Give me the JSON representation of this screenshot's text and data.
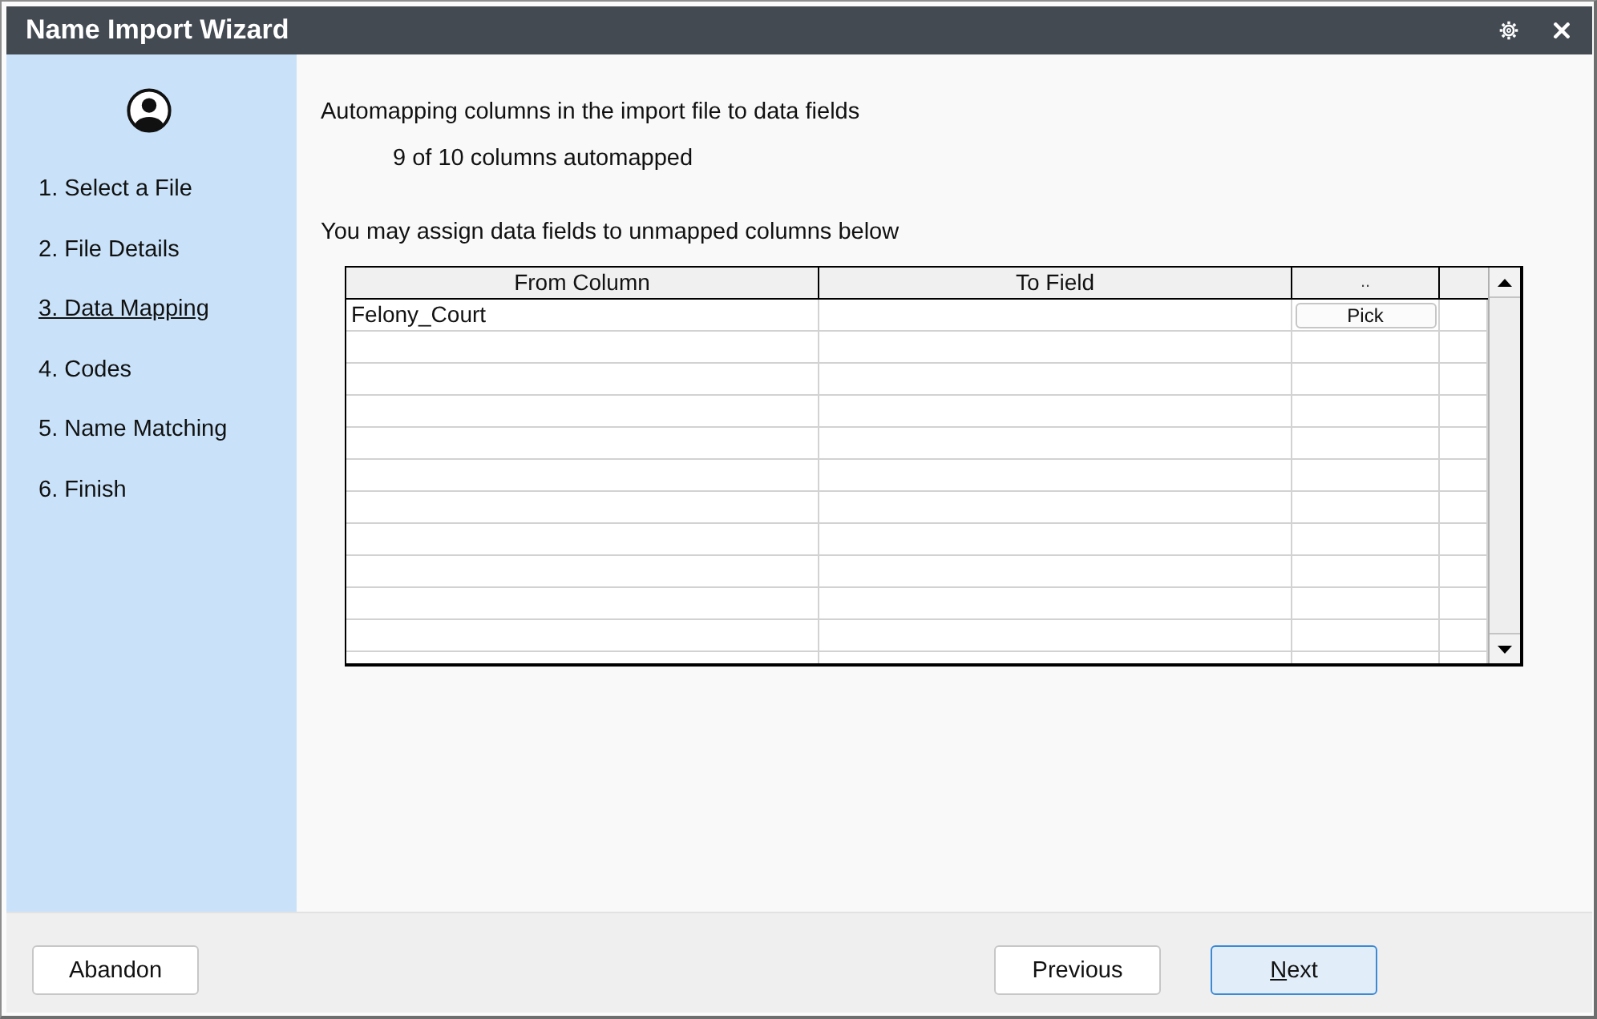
{
  "window": {
    "title": "Name Import Wizard"
  },
  "steps": [
    {
      "label": "1. Select a File",
      "selected": false
    },
    {
      "label": "2. File Details",
      "selected": false
    },
    {
      "label": "3. Data Mapping",
      "selected": true
    },
    {
      "label": "4. Codes",
      "selected": false
    },
    {
      "label": "5. Name Matching",
      "selected": false
    },
    {
      "label": "6. Finish",
      "selected": false
    }
  ],
  "content": {
    "heading": "Automapping columns in the import file to data fields",
    "status": "9 of 10 columns automapped",
    "instruction": "You may assign data fields to unmapped columns below"
  },
  "table": {
    "columns": [
      "From Column",
      "To Field",
      ".."
    ],
    "rows": [
      {
        "from_column": "Felony_Court",
        "action": "Pick"
      }
    ]
  },
  "footer": {
    "left_buttons": [
      {
        "label": "Abandon",
        "default": false,
        "access_key_underlined": false
      }
    ],
    "right_buttons": [
      {
        "label": "Previous",
        "default": false,
        "access_key_underlined": false
      },
      {
        "label": "Next",
        "default": true,
        "access_key_underlined": true
      }
    ]
  }
}
